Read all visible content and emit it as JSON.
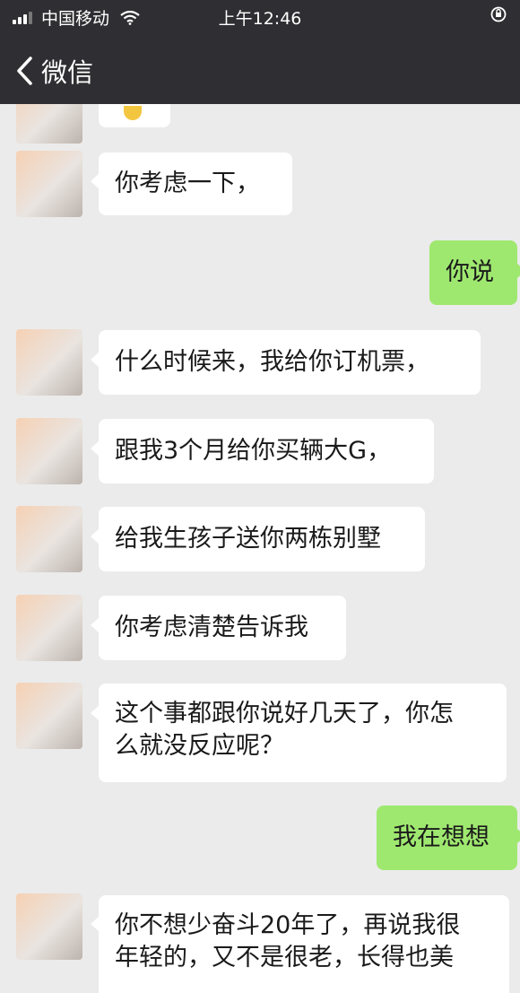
{
  "status_bar": {
    "carrier": "中国移动",
    "time": "上午12:46",
    "right_icon": "rotation-lock-icon",
    "wifi_icon": "wifi-icon",
    "signal_icon": "signal-icon"
  },
  "nav": {
    "back_label": "微信",
    "back_icon": "chevron-left-icon"
  },
  "messages": [
    {
      "side": "left",
      "text": ""
    },
    {
      "side": "left",
      "text": "你考虑一下，"
    },
    {
      "side": "right",
      "text": "你说"
    },
    {
      "side": "left",
      "text": "什么时候来，我给你订机票，"
    },
    {
      "side": "left",
      "text": "跟我3个月给你买辆大G，"
    },
    {
      "side": "left",
      "text": "给我生孩子送你两栋别墅"
    },
    {
      "side": "left",
      "text": "你考虑清楚告诉我"
    },
    {
      "side": "left",
      "text": "这个事都跟你说好几天了，你怎\n么就没反应呢？"
    },
    {
      "side": "right",
      "text": "我在想想"
    },
    {
      "side": "left",
      "text": "你不想少奋斗20年了，再说我很\n年轻的，又不是很老，长得也美"
    }
  ],
  "colors": {
    "header_bg": "#2f2f33",
    "chat_bg": "#ebebeb",
    "bubble_left": "#ffffff",
    "bubble_right": "#9fe870"
  }
}
